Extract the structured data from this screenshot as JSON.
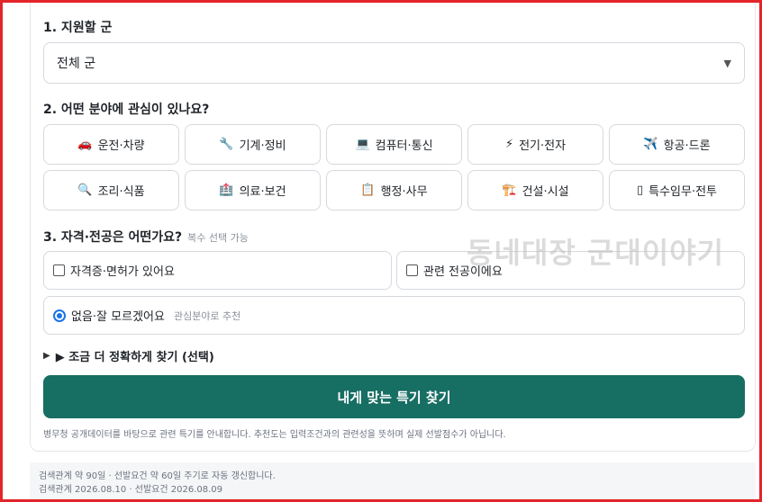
{
  "section1": {
    "title": "1. 지원할 군",
    "select_value": "전체 군",
    "caret": "▼"
  },
  "section2": {
    "title": "2. 어떤 분야에 관심이 있나요?",
    "fields": [
      {
        "icon": "🚗",
        "label": "운전·차량"
      },
      {
        "icon": "🔧",
        "label": "기계·정비"
      },
      {
        "icon": "💻",
        "label": "컴퓨터·통신"
      },
      {
        "icon": "⚡",
        "label": "전기·전자"
      },
      {
        "icon": "✈️",
        "label": "항공·드론"
      },
      {
        "icon": "🔍",
        "label": "조리·식품"
      },
      {
        "icon": "🏥",
        "label": "의료·보건"
      },
      {
        "icon": "📋",
        "label": "행정·사무"
      },
      {
        "icon": "🏗️",
        "label": "건설·시설"
      },
      {
        "icon": "▯",
        "label": "특수임무·전투"
      }
    ]
  },
  "section3": {
    "title": "3. 자격·전공은 어떤가요?",
    "hint": "복수 선택 가능",
    "options": [
      {
        "label": "자격증·면허가 있어요"
      },
      {
        "label": "관련 전공이에요"
      },
      {
        "label": "없음·잘 모르겠어요",
        "sub": "관심분야로 추천"
      }
    ]
  },
  "details": {
    "arrow": "▶",
    "label": "▶ 조금 더 정확하게 찾기 (선택)"
  },
  "cta": {
    "label": "내게 맞는 특기 찾기"
  },
  "notice": "병무청 공개데이터를 바탕으로 관련 특기를 안내합니다. 추천도는 입력조건과의 관련성을 뜻하며 실제 선발점수가 아닙니다.",
  "footer": {
    "line1": "검색관계 약 90일 · 선발요건 약 60일 주기로 자동 갱신합니다.",
    "line2": "검색관계 2026.08.10 · 선발요건 2026.08.09"
  },
  "watermark": "동네대장 군대이야기",
  "colors": {
    "accent": "#176e63",
    "frame": "#e3242b",
    "radio": "#1a73e8"
  }
}
